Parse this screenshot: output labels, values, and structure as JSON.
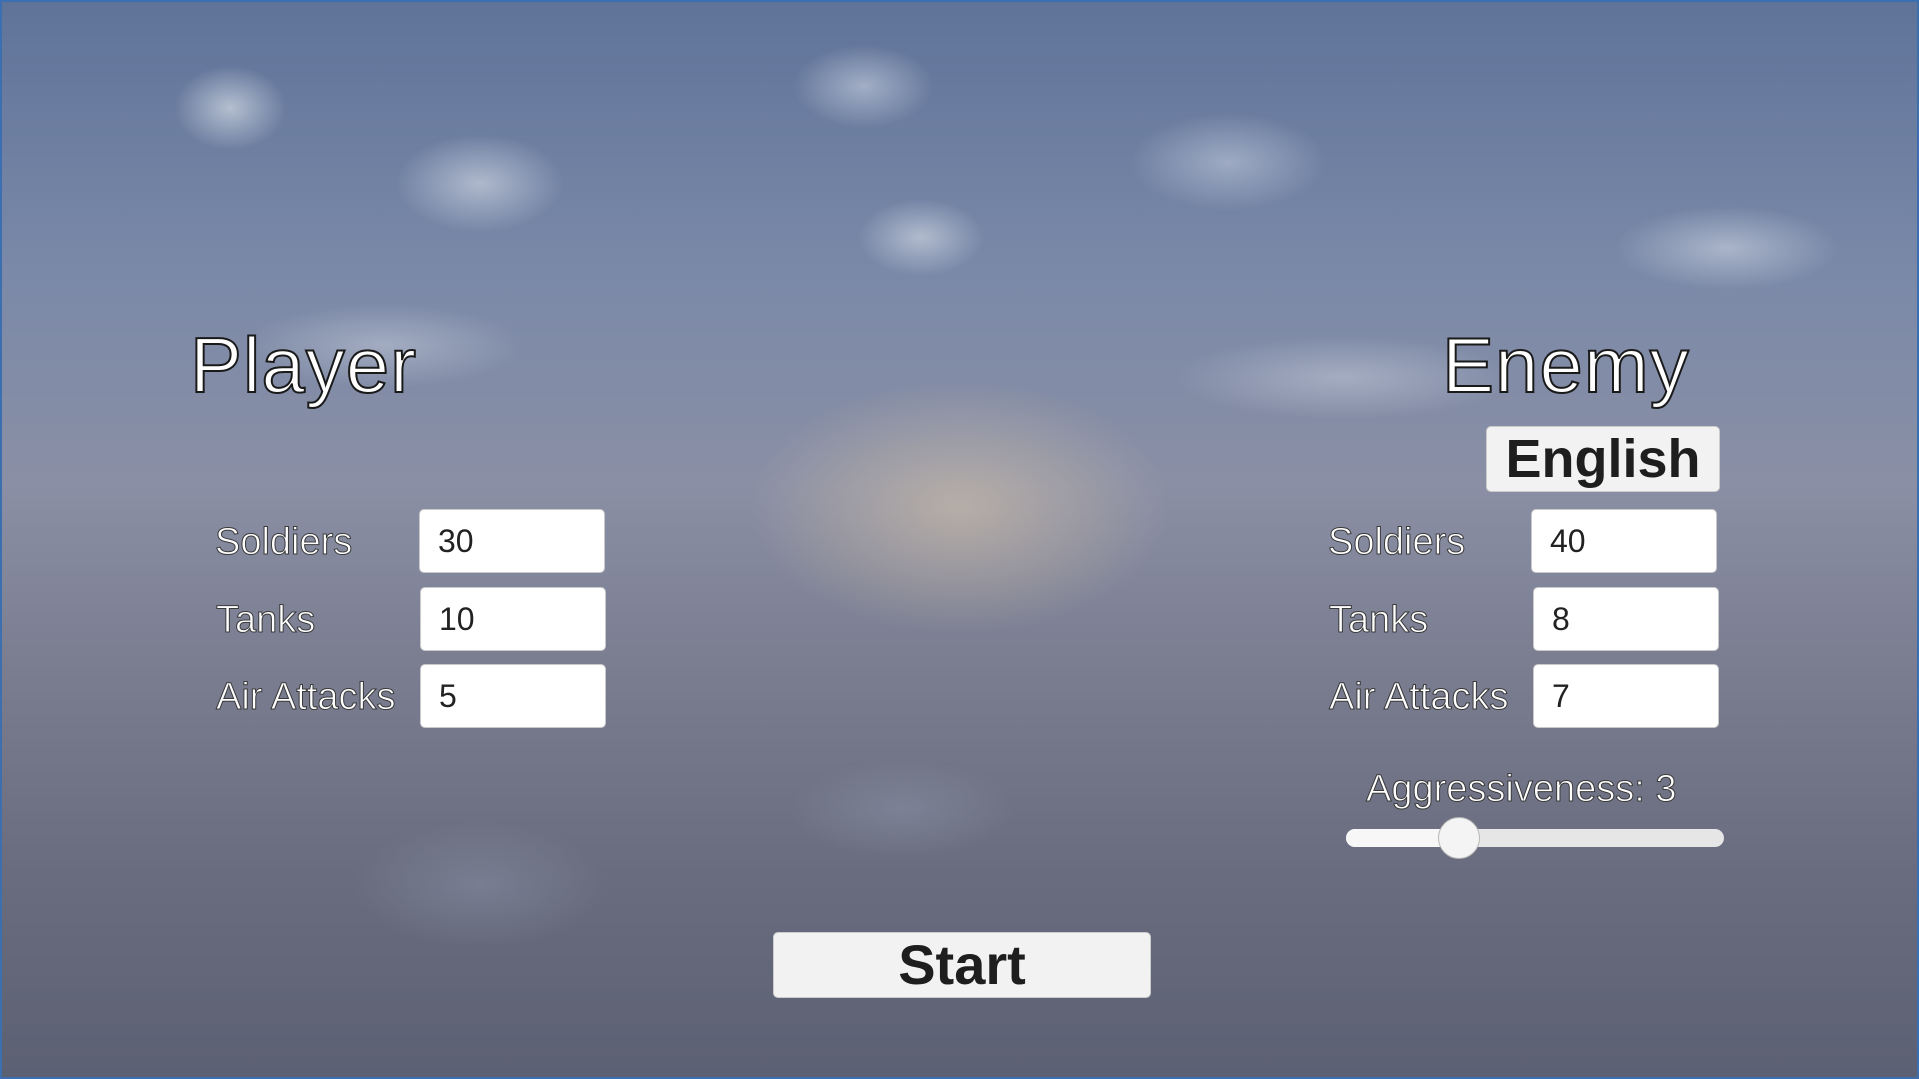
{
  "player": {
    "title": "Player",
    "soldiers": {
      "label": "Soldiers",
      "value": "30"
    },
    "tanks": {
      "label": "Tanks",
      "value": "10"
    },
    "air_attacks": {
      "label": "Air Attacks",
      "value": "5"
    }
  },
  "enemy": {
    "title": "Enemy",
    "language_button": "English",
    "soldiers": {
      "label": "Soldiers",
      "value": "40"
    },
    "tanks": {
      "label": "Tanks",
      "value": "8"
    },
    "air_attacks": {
      "label": "Air Attacks",
      "value": "7"
    },
    "aggressiveness": {
      "label": "Aggressiveness: 3",
      "value": 3,
      "fraction": 0.3
    }
  },
  "start_button": "Start"
}
